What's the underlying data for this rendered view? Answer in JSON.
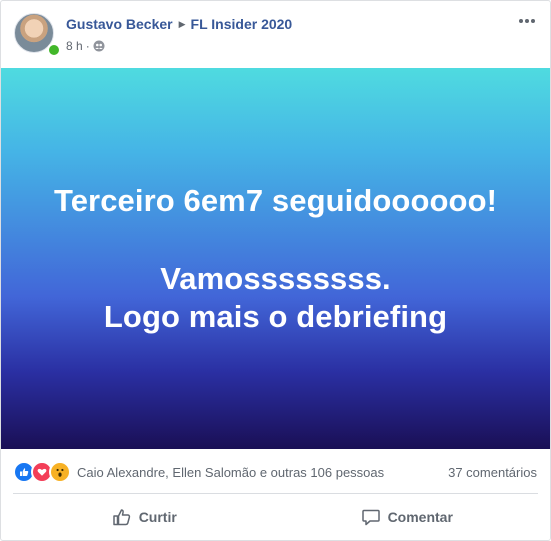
{
  "post": {
    "author": "Gustavo Becker",
    "group": "FL Insider 2020",
    "time": "8 h",
    "separator": "·",
    "privacy_icon": "group-icon",
    "more_icon": "more-options-icon"
  },
  "banner": {
    "line1": "Terceiro 6em7 seguidoooooo!",
    "line2": "Vamossssssss.",
    "line3": "Logo mais o debriefing",
    "gradient_top": "#4fdbe0",
    "gradient_bottom": "#1a0f55"
  },
  "reactions": {
    "icons": [
      "like-icon",
      "love-icon",
      "wow-icon"
    ],
    "names": "Caio Alexandre, Ellen Salomão e outras 106 pessoas",
    "comments": "37 comentários"
  },
  "actions": {
    "like_label": "Curtir",
    "comment_label": "Comentar"
  },
  "colors": {
    "link": "#385898",
    "secondary_text": "#606770",
    "online": "#42b72a",
    "like": "#1877f2",
    "love": "#f33e58",
    "wow": "#f7b125"
  }
}
